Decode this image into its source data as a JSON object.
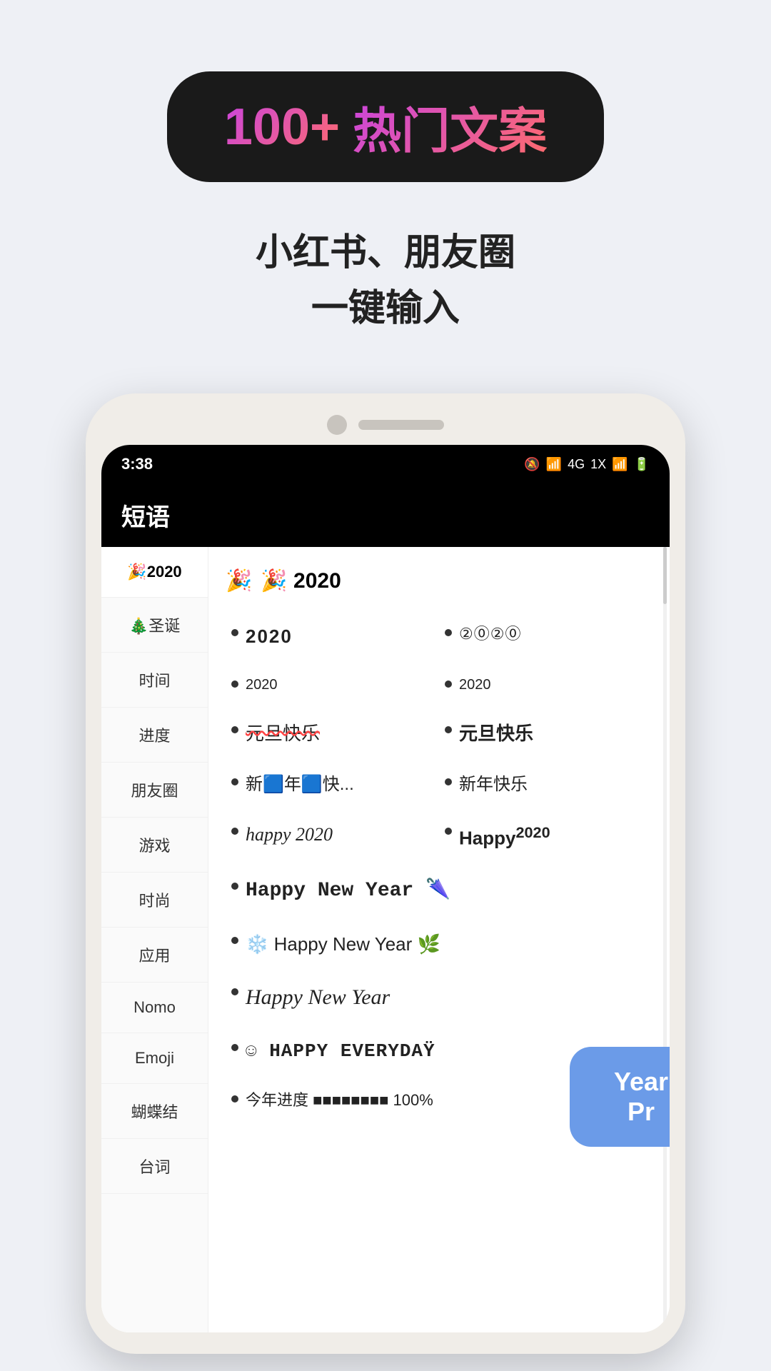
{
  "badge": {
    "number": "100+",
    "text": "热门文案"
  },
  "subtitle": {
    "line1": "小红书、朋友圈",
    "line2": "一键输入"
  },
  "phone": {
    "status_bar": {
      "time": "3:38",
      "icons": "🔕 📶 4G 1X 📶 🔋"
    },
    "app_title": "短语",
    "sidebar": {
      "items": [
        {
          "label": "🎉2020",
          "active": true
        },
        {
          "label": "🎄圣诞",
          "active": false
        },
        {
          "label": "时间",
          "active": false
        },
        {
          "label": "进度",
          "active": false
        },
        {
          "label": "朋友圈",
          "active": false
        },
        {
          "label": "游戏",
          "active": false
        },
        {
          "label": "时尚",
          "active": false
        },
        {
          "label": "应用",
          "active": false
        },
        {
          "label": "Nomo",
          "active": false
        },
        {
          "label": "Emoji",
          "active": false
        },
        {
          "label": "蝴蝶结",
          "active": false
        },
        {
          "label": "台词",
          "active": false
        }
      ]
    },
    "section_header": "🎉 2020",
    "items": [
      {
        "text": "2020",
        "style": "bold-serif",
        "col": 1
      },
      {
        "text": "②⓪②⓪",
        "style": "circled",
        "col": 2
      },
      {
        "text": "2020",
        "style": "small",
        "col": 1
      },
      {
        "text": "2020",
        "style": "small",
        "col": 2
      },
      {
        "text": "元旦快乐",
        "style": "strikethrough-r",
        "col": 1
      },
      {
        "text": "元旦快乐",
        "style": "bold",
        "col": 2
      },
      {
        "text": "新🟦年🟦快...",
        "style": "normal",
        "col": 1
      },
      {
        "text": "新年快乐",
        "style": "normal",
        "col": 2
      },
      {
        "text": "happy 2020",
        "style": "italic",
        "col": 1
      },
      {
        "text": "Happy²⁰²⁰",
        "style": "bold",
        "col": 2
      },
      {
        "text": "Happy New Year 🌂",
        "style": "decorative",
        "col": "full"
      },
      {
        "text": "❄️ Happy New Year 🌿",
        "style": "normal",
        "col": "full"
      },
      {
        "text": "Happy New Year",
        "style": "cursive",
        "col": "full"
      },
      {
        "text": "☺ HAPPY EVERYDAŸ",
        "style": "decorative",
        "col": "full"
      },
      {
        "text": "今年进度 ■■■■■■■■ 100%",
        "style": "progress",
        "col": "full"
      }
    ],
    "speech_bubble_text": "Year Pr"
  }
}
